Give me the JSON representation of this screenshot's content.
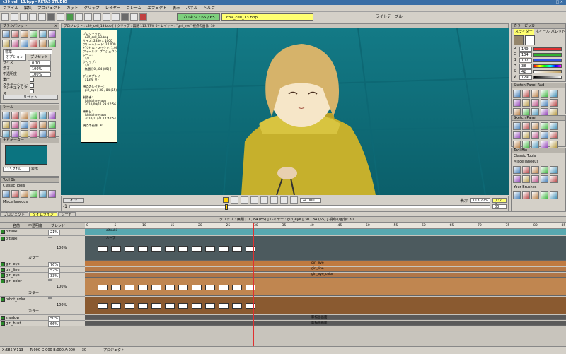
{
  "window": {
    "title": "c39_cell_13.bpp - RETAS STUDIO",
    "controls": "_ □ ×"
  },
  "menu": [
    "ファイル",
    "編集",
    "プロジェクト",
    "カット",
    "クリップ",
    "レイヤー",
    "フレーム",
    "エフェクト",
    "表示",
    "パネル",
    "ヘルプ"
  ],
  "toolbar": {
    "proxy_tab": "プロキシ : 65 / 65",
    "file_tab": "c39_cell_13.bpp",
    "light_table": "ライトテーブル"
  },
  "canvas_header": "プロジェクト : c39_cell_13.bpp [  ] クリップ : 無題 113.77% 0 - レイヤー : \"girl_eye\" 視点の画像: 30",
  "tooltip": "プロジェクト:\n  c39_cell_13.bpp\nサイズ: 2350 x 1000\nフレームレート: 24.000\nピクセルアスペクト: 1.000\nフィールド: プロジェクション\nシーン:\n  1/1\nクリップ:\n  1/1\n  無題 [ 0 , 84 (85) ]\n\nディスプレイ\n  113%  0 -\n\n視点のレイヤー:\n  girl_eye [ 30 , 84 (55) ]\n\n制作者:\n  ishidahireyasu\n  2010/09/11 23:17:56\n\n更新日:\n  ishidahireyasu\n  2010/11/21 14:44:54\n\n視点の画像: 30",
  "left": {
    "brush_panel": "ブラシパレット",
    "preset_label": "標準",
    "tabs": [
      "オプション",
      "プリセット"
    ],
    "options": [
      {
        "label": "サイズ",
        "value": "0.10"
      },
      {
        "label": "濃さ",
        "value": "100%"
      },
      {
        "label": "不透明度",
        "value": "100%"
      },
      {
        "label": "筆圧",
        "value": ""
      },
      {
        "label": "グラデーション",
        "value": ""
      },
      {
        "label": "アンチエイリアス",
        "value": ""
      }
    ],
    "reset": "リセット",
    "tool_panel": "ツール",
    "nav_panel": "ナビゲーター",
    "nav_zoom": "113.77%",
    "nav_display": "表示",
    "toolbin_title": "Tool Bin",
    "toolbin_classic": "Classic Tools",
    "toolbin_misc": "Miscellaneous"
  },
  "right": {
    "color_picker": "カラーピッカー",
    "tabs": [
      "スライダー",
      "ホイール",
      "パレット"
    ],
    "sliders": [
      {
        "label": "R",
        "value": "149"
      },
      {
        "label": "G",
        "value": "134"
      },
      {
        "label": "B",
        "value": "107"
      },
      {
        "label": "H",
        "value": "38"
      },
      {
        "label": "S",
        "value": "42"
      },
      {
        "label": "V",
        "value": "129"
      }
    ],
    "sketch_rad": "Sketch Panel Rad",
    "sketch_panel": "Sketch Panel",
    "toolbin_title": "Tool Bin",
    "classic": "Classic Tools",
    "misc": "Miscellaneous",
    "brushes": "Your Brushes"
  },
  "playback": {
    "left_btn": "イン",
    "value_left": "-1",
    "fps": "24.000",
    "display": "表示",
    "zoom": "113.77%",
    "out_btn": "アウト",
    "out_val": "80"
  },
  "tabs_row": [
    "プロジェクト",
    "タイムライン",
    "シート"
  ],
  "timeline_header": "クリップ : 無題 [ 0 , 84 (85) ]        レイヤー : girl_eye [ 30 , 84 (55) ]    視点の画像: 30",
  "ruler": [
    "0",
    "5",
    "10",
    "15",
    "20",
    "25",
    "30",
    "35",
    "40",
    "45",
    "50",
    "55",
    "60",
    "65",
    "70",
    "75",
    "80",
    "85"
  ],
  "layers": [
    {
      "name": "oitsuki",
      "opacity": "21%",
      "clip": "oitsuki"
    },
    {
      "name": "oitsuki",
      "opacity": "",
      "clip": "ループ"
    },
    {
      "name": "girl_eye",
      "opacity": "76%",
      "clip": "girl_eye"
    },
    {
      "name": "girl_line",
      "opacity": "52%",
      "clip": "girl_line"
    },
    {
      "name": "girl_eye...",
      "opacity": "33%",
      "clip": "girl_eye_color"
    },
    {
      "name": "girl_color",
      "opacity": "",
      "clip": ""
    },
    {
      "name": "robot_color",
      "opacity": "",
      "clip": ""
    },
    {
      "name": "shadow",
      "opacity": "50%",
      "clip": "影描画画面"
    },
    {
      "name": "girl_hust",
      "opacity": "66%",
      "clip": "影描画画面"
    }
  ],
  "layer_header": {
    "col1": "名前",
    "col2": "不透明度",
    "col3": "ブレンド"
  },
  "color_label": "カラー",
  "opacity_small": "100%",
  "status": {
    "coords": "X:585 Y:113",
    "rgb": "R:000 G:000 B:000 A:000",
    "frame": "30",
    "project": "プロジェクト"
  }
}
